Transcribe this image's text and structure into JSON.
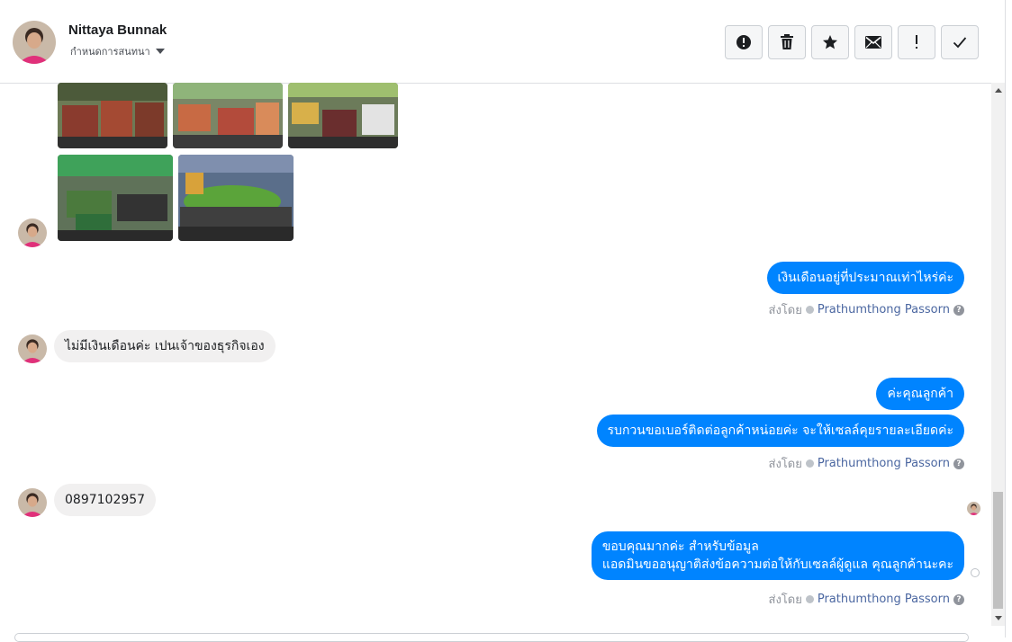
{
  "header": {
    "contact_name": "Nittaya Bunnak",
    "assign_label": "กำหนดการสนทนา",
    "toolbar": [
      {
        "name": "spam-button",
        "icon": "alert-circle-icon"
      },
      {
        "name": "delete-button",
        "icon": "trash-icon"
      },
      {
        "name": "star-button",
        "icon": "star-icon"
      },
      {
        "name": "mark-unread-button",
        "icon": "envelope-icon"
      },
      {
        "name": "follow-up-button",
        "icon": "exclamation-icon"
      },
      {
        "name": "mark-done-button",
        "icon": "check-icon"
      }
    ]
  },
  "messages": {
    "m1": {
      "text": "เงินเดือนอยู่ที่ประมาณเท่าไหร่ค่ะ"
    },
    "m2": {
      "text": "ไม่มีเงินเดือนค่ะ เปนเจ้าของธุรกิจเอง"
    },
    "m3": {
      "text": "ค่ะคุณลูกค้า"
    },
    "m4": {
      "text": "รบกวนขอเบอร์ติดต่อลูกค้าหน่อยค่ะ จะให้เซลล์คุยรายละเอียดค่ะ"
    },
    "m5": {
      "text": "0897102957"
    },
    "m6": {
      "line1": "ขอบคุณมากค่ะ สำหรับข้อมูล",
      "line2": "แอดมินขออนุญาติส่งข้อความต่อให้กับเซลล์ผู้ดูแล คุณลูกค้านะคะ"
    }
  },
  "sent_by": {
    "label": "ส่งโดย",
    "agent": "Prathumthong Passorn",
    "help": "?"
  },
  "colors": {
    "outgoing_bubble": "#0084ff",
    "incoming_bubble": "#f1f0f0",
    "agent_link": "#4b67a1"
  }
}
